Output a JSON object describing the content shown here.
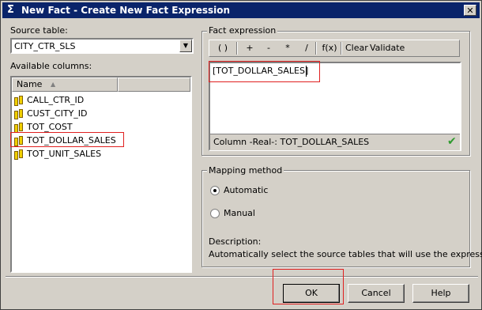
{
  "window": {
    "title": "New Fact - Create New Fact Expression",
    "icon": "sigma-icon",
    "icon_glyph": "Σ",
    "close_glyph": "✕"
  },
  "left": {
    "source_label": "Source table:",
    "source_value": "CITY_CTR_SLS",
    "available_label": "Available columns:",
    "column_header": "Name",
    "sort_glyph": "▲",
    "columns": [
      "CALL_CTR_ID",
      "CUST_CITY_ID",
      "TOT_COST",
      "TOT_DOLLAR_SALES",
      "TOT_UNIT_SALES"
    ],
    "highlighted_column": "TOT_DOLLAR_SALES"
  },
  "fact_expression": {
    "group_label": "Fact expression",
    "toolbar": {
      "paren": "( )",
      "plus": "+",
      "minus": "-",
      "mult": "*",
      "div": "/",
      "fx": "f(x)",
      "clear": "Clear",
      "validate": "Validate"
    },
    "expression_text": "[TOT_DOLLAR_SALES]",
    "status_text": "Column -Real-: TOT_DOLLAR_SALES",
    "status_check": "✔",
    "check_color": "#2e9a2e"
  },
  "mapping": {
    "group_label": "Mapping method",
    "option_automatic": "Automatic",
    "option_manual": "Manual",
    "selected": "Automatic",
    "description_label": "Description:",
    "description_text": "Automatically select the source tables that will use the expression"
  },
  "buttons": {
    "ok": "OK",
    "cancel": "Cancel",
    "help": "Help"
  },
  "colors": {
    "title_bar": "#0a246a",
    "highlight_box": "#e02020",
    "dialog_bg": "#d4d0c8"
  }
}
